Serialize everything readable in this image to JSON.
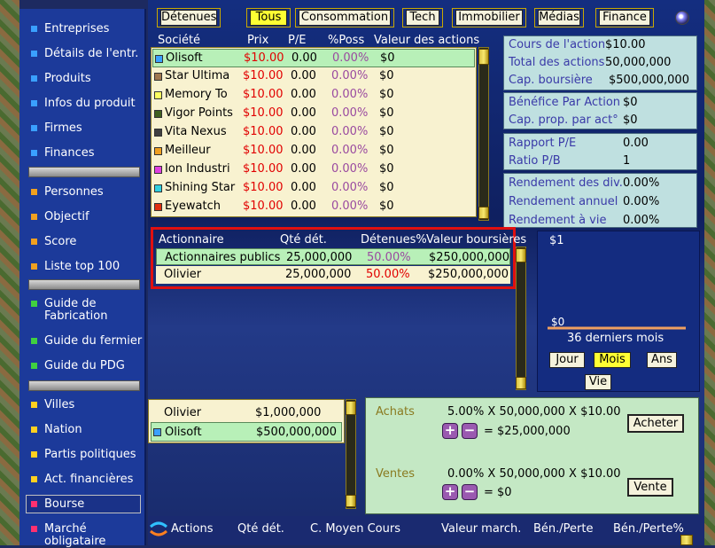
{
  "sidebar": {
    "items": [
      {
        "label": "Entreprises",
        "color": "#3aa0ff"
      },
      {
        "label": "Détails de l'entr.",
        "color": "#3aa0ff"
      },
      {
        "label": "Produits",
        "color": "#3aa0ff"
      },
      {
        "label": "Infos du produit",
        "color": "#3aa0ff"
      },
      {
        "label": "Firmes",
        "color": "#3aa0ff"
      },
      {
        "label": "Finances",
        "color": "#3aa0ff"
      },
      {
        "label": "Personnes",
        "color": "#f0a020"
      },
      {
        "label": "Objectif",
        "color": "#f0a020"
      },
      {
        "label": "Score",
        "color": "#f0a020"
      },
      {
        "label": "Liste top 100",
        "color": "#f0a020"
      },
      {
        "label": "Guide de Fabrication",
        "color": "#40d040"
      },
      {
        "label": "Guide du fermier",
        "color": "#40d040"
      },
      {
        "label": "Guide du PDG",
        "color": "#40d040"
      },
      {
        "label": "Villes",
        "color": "#ffd020"
      },
      {
        "label": "Nation",
        "color": "#ffd020"
      },
      {
        "label": "Partis politiques",
        "color": "#ffd020"
      },
      {
        "label": "Act. financières",
        "color": "#ffd020"
      },
      {
        "label": "Bourse",
        "color": "#ff3070"
      },
      {
        "label": "Marché obligataire",
        "color": "#ff3070"
      }
    ]
  },
  "tabs": {
    "detenues": "Détenues",
    "tous": "Tous",
    "consommation": "Consommation",
    "tech": "Tech",
    "immobilier": "Immobilier",
    "medias": "Médias",
    "finance": "Finance"
  },
  "stock_table": {
    "headers": {
      "societe": "Société",
      "prix": "Prix",
      "pe": "P/E",
      "poss": "%Poss",
      "valeur": "Valeur des actions"
    },
    "rows": [
      {
        "name": "Olisoft",
        "price": "$10.00",
        "pe": "0.00",
        "poss": "0.00%",
        "value": "$0",
        "color": "#3aa0ff"
      },
      {
        "name": "Star Ultima",
        "price": "$10.00",
        "pe": "0.00",
        "poss": "0.00%",
        "value": "$0",
        "color": "#a07850"
      },
      {
        "name": "Memory To",
        "price": "$10.00",
        "pe": "0.00",
        "poss": "0.00%",
        "value": "$0",
        "color": "#ffff60"
      },
      {
        "name": "Vigor Points",
        "price": "$10.00",
        "pe": "0.00",
        "poss": "0.00%",
        "value": "$0",
        "color": "#406020"
      },
      {
        "name": "Vita Nexus",
        "price": "$10.00",
        "pe": "0.00",
        "poss": "0.00%",
        "value": "$0",
        "color": "#404040"
      },
      {
        "name": "Meilleur",
        "price": "$10.00",
        "pe": "0.00",
        "poss": "0.00%",
        "value": "$0",
        "color": "#f0a020"
      },
      {
        "name": "Ion Industri",
        "price": "$10.00",
        "pe": "0.00",
        "poss": "0.00%",
        "value": "$0",
        "color": "#e040e0"
      },
      {
        "name": "Shining Star",
        "price": "$10.00",
        "pe": "0.00",
        "poss": "0.00%",
        "value": "$0",
        "color": "#30d0e0"
      },
      {
        "name": "Eyewatch",
        "price": "$10.00",
        "pe": "0.00",
        "poss": "0.00%",
        "value": "$0",
        "color": "#e03010"
      }
    ]
  },
  "stock_info": {
    "cours_label": "Cours de l'action",
    "cours_value": "$10.00",
    "total_label": "Total des actions",
    "total_value": "50,000,000",
    "cap_label": "Cap. boursière",
    "cap_value": "$500,000,000",
    "bpa_label": "Bénéfice Par Action",
    "bpa_value": "$0",
    "capprop_label": "Cap. prop. par act°",
    "capprop_value": "$0",
    "pe_label": "Rapport P/E",
    "pe_value": "0.00",
    "pb_label": "Ratio P/B",
    "pb_value": "1",
    "rdiv_label": "Rendement des div.",
    "rdiv_value": "0.00%",
    "rann_label": "Rendement annuel",
    "rann_value": "0.00%",
    "rvie_label": "Rendement à vie",
    "rvie_value": "0.00%"
  },
  "shareholders": {
    "headers": {
      "actionnaire": "Actionnaire",
      "qte": "Qté dét.",
      "det": "Détenues%",
      "valeur": "Valeur boursières"
    },
    "rows": [
      {
        "name": "Actionnaires publics",
        "qty": "25,000,000",
        "pct": "50.00%",
        "value": "$250,000,000"
      },
      {
        "name": "Olivier",
        "qty": "25,000,000",
        "pct": "50.00%",
        "value": "$250,000,000"
      }
    ]
  },
  "chart": {
    "top_label": "$1",
    "bottom_label": "$0",
    "period_label": "36 derniers mois",
    "btn_jour": "Jour",
    "btn_mois": "Mois",
    "btn_ans": "Ans",
    "btn_vie": "Vie"
  },
  "chart_data": {
    "type": "line",
    "series": [
      {
        "values": [
          0,
          0,
          0,
          0,
          0,
          0,
          0,
          0,
          0,
          0,
          0,
          0,
          0,
          0,
          0,
          0,
          0,
          0,
          0,
          0,
          0,
          0,
          0,
          0,
          0,
          0,
          0,
          0,
          0,
          0,
          0,
          0,
          0,
          0,
          0,
          0
        ]
      }
    ],
    "ylim": [
      0,
      1
    ],
    "ylabel": "",
    "xlabel": "36 derniers mois",
    "title": ""
  },
  "holders": {
    "rows": [
      {
        "name": "Olivier",
        "value": "$1,000,000"
      },
      {
        "name": "Olisoft",
        "value": "$500,000,000"
      }
    ]
  },
  "trade": {
    "achats_label": "Achats",
    "achats_formula": "5.00% X 50,000,000 X $10.00",
    "achats_result": "= $25,000,000",
    "acheter": "Acheter",
    "ventes_label": "Ventes",
    "ventes_formula": "0.00% X 50,000,000 X $10.00",
    "ventes_result": "= $0",
    "vente": "Vente"
  },
  "bottom_header": {
    "actions": "Actions",
    "qte": "Qté dét.",
    "cmoyen": "C. Moyen Cours",
    "valeur": "Valeur march.",
    "ben": "Bén./Perte",
    "benpct": "Bén./Perte%"
  }
}
